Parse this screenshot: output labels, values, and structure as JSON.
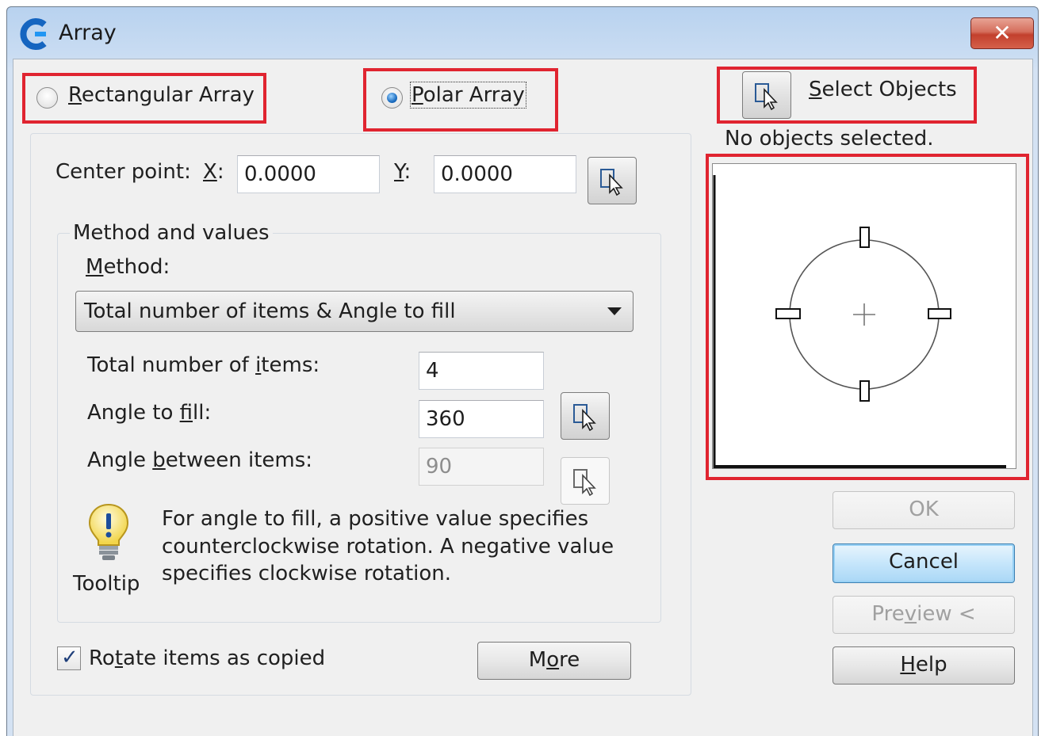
{
  "window": {
    "title": "Array",
    "close_glyph": "✕"
  },
  "array_type": {
    "rectangular": {
      "before": "",
      "key": "R",
      "after": "ectangular Array",
      "selected": false
    },
    "polar": {
      "before": "",
      "key": "P",
      "after": "olar Array",
      "selected": true
    }
  },
  "select_objects": {
    "before": "",
    "key": "S",
    "after": "elect Objects",
    "status": "No objects selected.",
    "icon": "pick-objects-icon"
  },
  "center_point": {
    "label": "Center point:",
    "x_label": {
      "key": "X",
      "after": ":"
    },
    "x_value": "0.0000",
    "y_label": {
      "key": "Y",
      "after": ":"
    },
    "y_value": "0.0000"
  },
  "method_group": {
    "title": "Method and values",
    "method_label": {
      "before": "",
      "key": "M",
      "after": "ethod:"
    },
    "method_selected": "Total number of items & Angle to fill",
    "total_items": {
      "before": "Total number of ",
      "key": "i",
      "after": "tems:",
      "value": "4"
    },
    "angle_fill": {
      "before": "Angle to ",
      "key": "f",
      "after": "ill:",
      "value": "360"
    },
    "angle_between": {
      "before": "Angle ",
      "key": "b",
      "after": "etween items:",
      "value": "90",
      "enabled": false
    }
  },
  "tooltip": {
    "label": "Tooltip",
    "lines": [
      "For angle to fill, a positive value specifies",
      "counterclockwise rotation.  A negative value",
      "specifies clockwise rotation."
    ]
  },
  "rotate_items": {
    "before": "Ro",
    "key": "t",
    "after": "ate items as copied",
    "checked": true,
    "check_glyph": "✓"
  },
  "buttons": {
    "more": {
      "before": "M",
      "key": "o",
      "after": "re"
    },
    "ok": {
      "label": "OK",
      "enabled": false
    },
    "cancel": {
      "label": "Cancel"
    },
    "preview": {
      "before": "Pre",
      "key": "v",
      "after": "iew <",
      "enabled": false
    },
    "help": {
      "before": "",
      "key": "H",
      "after": "elp"
    }
  },
  "colors": {
    "highlight": "#e02430",
    "accent": "#1e6fc2"
  }
}
